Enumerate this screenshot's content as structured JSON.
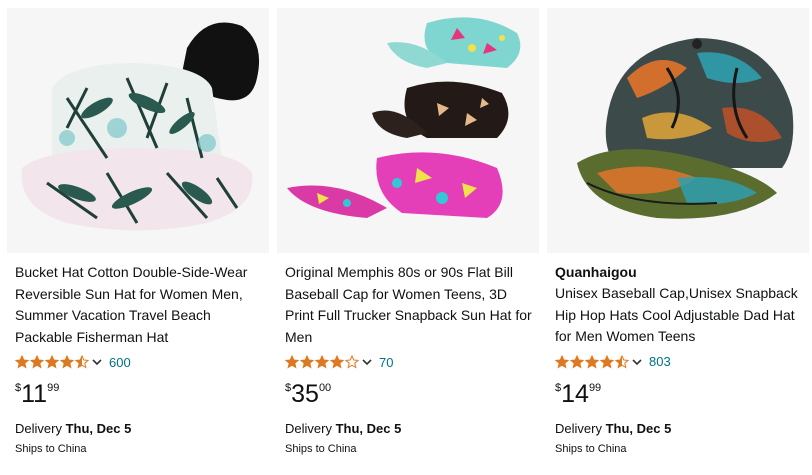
{
  "products": [
    {
      "brand": "",
      "title": "Bucket Hat Cotton Double-Side-Wear Reversible Sun Hat for Women Men, Summer Vacation Travel Beach Packable Fisherman Hat",
      "rating": 4.5,
      "reviews": "600",
      "price_symbol": "$",
      "price_whole": "11",
      "price_fraction": "99",
      "delivery_label": "Delivery",
      "delivery_date": "Thu, Dec 5",
      "ships_to": "Ships to China",
      "image_icon": "bucket-hat-palm-print"
    },
    {
      "brand": "",
      "title": "Original Memphis 80s or 90s Flat Bill Baseball Cap for Women Teens, 3D Print Full Trucker Snapback Sun Hat for Men",
      "rating": 4.0,
      "reviews": "70",
      "price_symbol": "$",
      "price_whole": "35",
      "price_fraction": "00",
      "delivery_label": "Delivery",
      "delivery_date": "Thu, Dec 5",
      "ships_to": "Ships to China",
      "image_icon": "memphis-flat-bill-caps"
    },
    {
      "brand": "Quanhaigou",
      "title": "Unisex Baseball Cap,Unisex Snapback Hip Hop Hats Cool Adjustable Dad Hat for Men Women Teens",
      "rating": 4.5,
      "reviews": "803",
      "price_symbol": "$",
      "price_whole": "14",
      "price_fraction": "99",
      "delivery_label": "Delivery",
      "delivery_date": "Thu, Dec 5",
      "ships_to": "Ships to China",
      "image_icon": "graffiti-baseball-cap"
    }
  ],
  "colors": {
    "star": "#de7921",
    "link": "#007185",
    "text": "#0f1111"
  }
}
